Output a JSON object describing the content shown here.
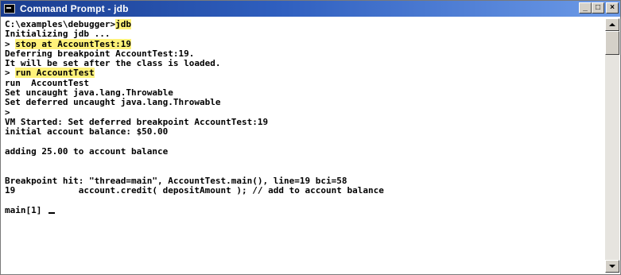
{
  "window": {
    "title": "Command Prompt - jdb",
    "controls": {
      "minimize": "_",
      "maximize": "□",
      "close": "×"
    },
    "icon": "console-icon"
  },
  "console": {
    "lines": [
      {
        "segments": [
          {
            "text": "C:\\examples\\debugger>"
          },
          {
            "text": "jdb",
            "highlight": true
          }
        ]
      },
      {
        "segments": [
          {
            "text": "Initializing jdb ..."
          }
        ]
      },
      {
        "segments": [
          {
            "text": "> "
          },
          {
            "text": "stop at AccountTest:19",
            "highlight": true
          }
        ]
      },
      {
        "segments": [
          {
            "text": "Deferring breakpoint AccountTest:19."
          }
        ]
      },
      {
        "segments": [
          {
            "text": "It will be set after the class is loaded."
          }
        ]
      },
      {
        "segments": [
          {
            "text": "> "
          },
          {
            "text": "run AccountTest",
            "highlight": true
          }
        ]
      },
      {
        "segments": [
          {
            "text": "run  AccountTest"
          }
        ]
      },
      {
        "segments": [
          {
            "text": "Set uncaught java.lang.Throwable"
          }
        ]
      },
      {
        "segments": [
          {
            "text": "Set deferred uncaught java.lang.Throwable"
          }
        ]
      },
      {
        "segments": [
          {
            "text": ">"
          }
        ]
      },
      {
        "segments": [
          {
            "text": "VM Started: Set deferred breakpoint AccountTest:19"
          }
        ]
      },
      {
        "segments": [
          {
            "text": "initial account balance: $50.00"
          }
        ]
      },
      {
        "segments": [
          {
            "text": ""
          }
        ]
      },
      {
        "segments": [
          {
            "text": "adding 25.00 to account balance"
          }
        ]
      },
      {
        "segments": [
          {
            "text": ""
          }
        ]
      },
      {
        "segments": [
          {
            "text": ""
          }
        ]
      },
      {
        "segments": [
          {
            "text": "Breakpoint hit: \"thread=main\", AccountTest.main(), line=19 bci=58"
          }
        ]
      },
      {
        "segments": [
          {
            "text": "19            account.credit( depositAmount ); // add to account balance"
          }
        ]
      },
      {
        "segments": [
          {
            "text": ""
          }
        ]
      },
      {
        "segments": [
          {
            "text": "main[1] "
          }
        ],
        "cursor": true
      }
    ],
    "highlight_color": "#fff27a"
  }
}
